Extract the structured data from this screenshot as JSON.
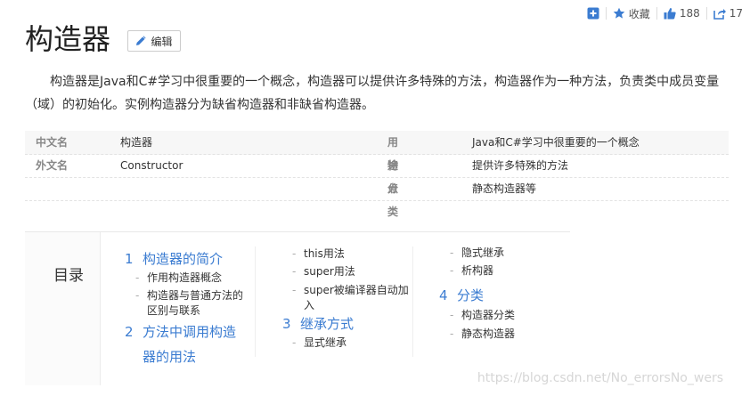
{
  "actions": {
    "add_label": "",
    "favorite_label": "收藏",
    "like_count": "188",
    "share_count": "17"
  },
  "title": "构造器",
  "edit_label": "编辑",
  "summary": "构造器是Java和C#学习中很重要的一个概念，构造器可以提供许多特殊的方法，构造器作为一种方法，负责类中成员变量（域）的初始化。实例构造器分为缺省构造器和非缺省构造器。",
  "info": {
    "rows": [
      {
        "label1": "中文名",
        "value1": "构造器",
        "label2": "用 途",
        "value2": "Java和C#学习中很重要的一个概念"
      },
      {
        "label1": "外文名",
        "value1": "Constructor",
        "label2": "特 点",
        "value2": "提供许多特殊的方法"
      },
      {
        "label1": "",
        "value1": "",
        "label2": "分 类",
        "value2": "静态构造器等"
      }
    ]
  },
  "catalog": {
    "label": "目录",
    "sections": [
      {
        "num": "1",
        "title": "构造器的简介"
      },
      {
        "num": "2",
        "title_line1": "方法中调用构造",
        "title_line2": "器的用法"
      },
      {
        "num": "3",
        "title": "继承方式"
      },
      {
        "num": "4",
        "title": "分类"
      }
    ],
    "items": {
      "intro_concept": "作用构造器概念",
      "intro_diff_line1": "构造器与普通方法的",
      "intro_diff_line2": "区别与联系",
      "this_usage": "this用法",
      "super_usage": "super用法",
      "super_auto_line1": "super被编译器自动加",
      "super_auto_line2": "入",
      "explicit_inherit": "显式继承",
      "implicit_inherit": "隐式继承",
      "destructor": "析构器",
      "ctor_category": "构造器分类",
      "static_ctor": "静态构造器"
    }
  },
  "watermark": "https://blog.csdn.net/No_errorsNo_wers",
  "colors": {
    "accent": "#3b7cd1",
    "text": "#333333",
    "muted": "#888888"
  }
}
